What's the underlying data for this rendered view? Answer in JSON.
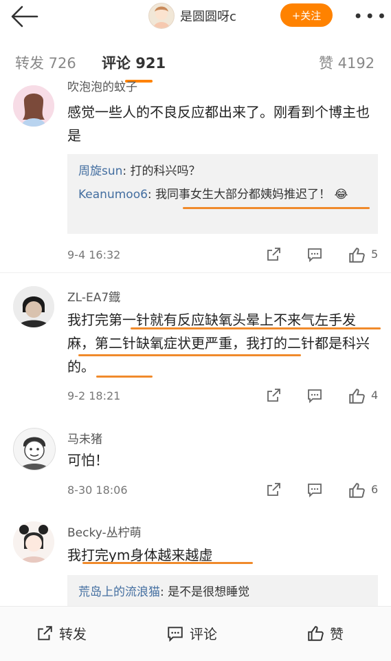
{
  "header": {
    "title": "是圆圆呀c",
    "follow_label": "+关注"
  },
  "tabs": {
    "repost": "转发 726",
    "comment": "评论 921",
    "like": "赞 4192"
  },
  "comments": [
    {
      "name": "吹泡泡的蚊子",
      "text": "感觉一些人的不良反应都出来了。刚看到个博主也是",
      "replies": [
        {
          "name": "周旋sun",
          "sep": ": ",
          "text": "打的科兴吗？"
        },
        {
          "name": "Keanumoo6",
          "sep": ": ",
          "text": "我同事女生大部分都姨妈推迟了！",
          "emoji": "😂"
        }
      ],
      "time": "9-4 16:32",
      "likes": "5"
    },
    {
      "name": "ZL-EA7鐡",
      "text": "我打完第一针就有反应缺氧头晕上不来气左手发麻，第二针缺氧症状更严重，我打的二针都是科兴的。",
      "time": "9-2 18:21",
      "likes": "4"
    },
    {
      "name": "马未猪",
      "text": "可怕！",
      "time": "8-30 18:06",
      "likes": "6"
    },
    {
      "name": "Becky-丛柠萌",
      "text": "我打完ym身体越来越虚",
      "replies": [
        {
          "name": "荒岛上的流浪猫",
          "sep": ": ",
          "text": "是不是很想睡觉"
        }
      ]
    }
  ],
  "bottombar": {
    "repost": "转发",
    "comment": "评论",
    "like": "赞"
  },
  "colors": {
    "accent": "#ff8200",
    "link": "#436ea0",
    "underline": "#f08a2b"
  }
}
